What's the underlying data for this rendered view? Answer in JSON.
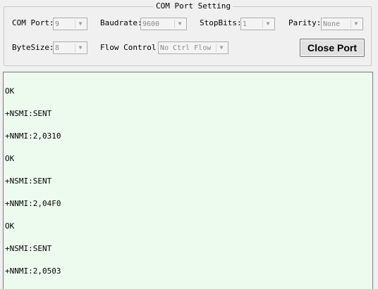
{
  "group": {
    "title": "COM Port Setting"
  },
  "com_port": {
    "label": "COM Port:",
    "value": "9"
  },
  "baudrate": {
    "label": "Baudrate:",
    "value": "9600"
  },
  "stopbits": {
    "label": "StopBits:",
    "value": "1"
  },
  "parity": {
    "label": "Parity:",
    "value": "None"
  },
  "bytesize": {
    "label": "ByteSize:",
    "value": "8"
  },
  "flow_control": {
    "label": "Flow Control:",
    "value": "No Ctrl Flow"
  },
  "close_button": {
    "label": "Close Port"
  },
  "icons": {
    "dropdown": "chevron-down-icon"
  },
  "colors": {
    "output_background": "#edfbef",
    "border": "#7a7a7a"
  },
  "output_lines": [
    "OK",
    "+NSMI:SENT",
    "+NNMI:2,0310",
    "OK",
    "+NSMI:SENT",
    "+NNMI:2,04F0",
    "OK",
    "+NSMI:SENT",
    "+NNMI:2,0503"
  ]
}
